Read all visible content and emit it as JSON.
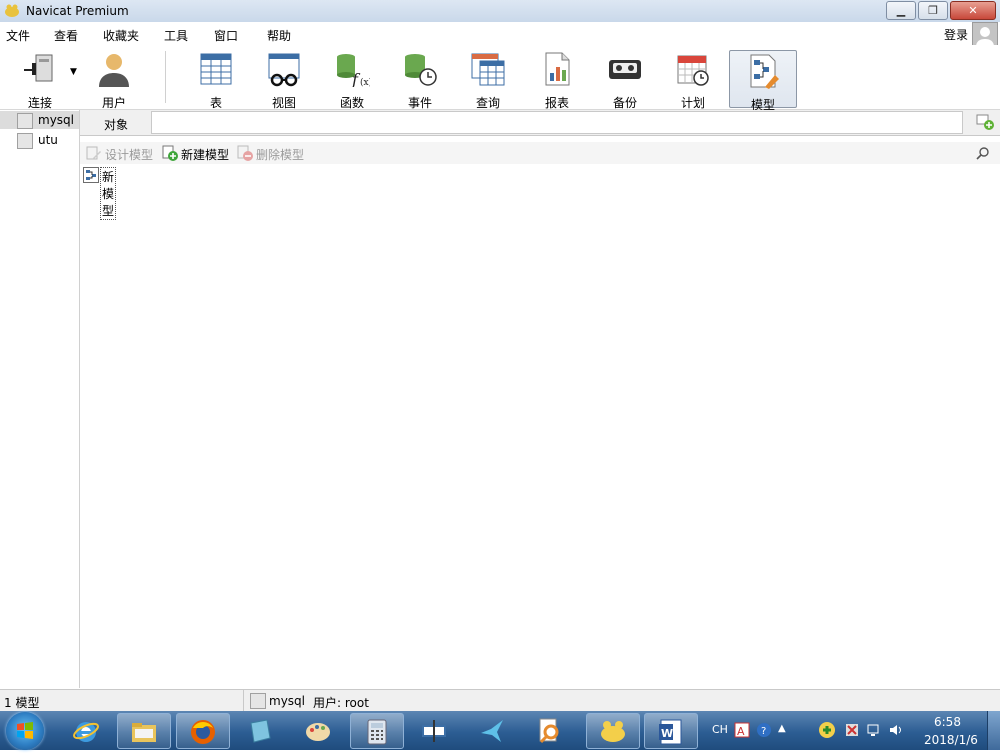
{
  "window": {
    "title": "Navicat Premium"
  },
  "menu": {
    "items": [
      "文件",
      "查看",
      "收藏夹",
      "工具",
      "窗口",
      "帮助"
    ],
    "login": "登录"
  },
  "toolbar": {
    "connect": "连接",
    "user": "用户",
    "table": "表",
    "view": "视图",
    "function": "函数",
    "event": "事件",
    "query": "查询",
    "report": "报表",
    "backup": "备份",
    "schedule": "计划",
    "model": "模型",
    "active": "model"
  },
  "connections": [
    "mysql",
    "utu"
  ],
  "tabs": {
    "objects": "对象"
  },
  "object_toolbar": {
    "design": "设计模型",
    "new": "新建模型",
    "delete": "删除模型"
  },
  "objects": [
    "新模型"
  ],
  "status": {
    "count": "1 模型",
    "connection": "mysql",
    "user": "用户: root"
  },
  "taskbar": {
    "lang": "CH",
    "time": "6:58",
    "date": "2018/1/6"
  },
  "colors": {
    "title_bar": "#c9d8ea",
    "taskbar": "#2c5d93",
    "selection": "#dcdcdc"
  }
}
